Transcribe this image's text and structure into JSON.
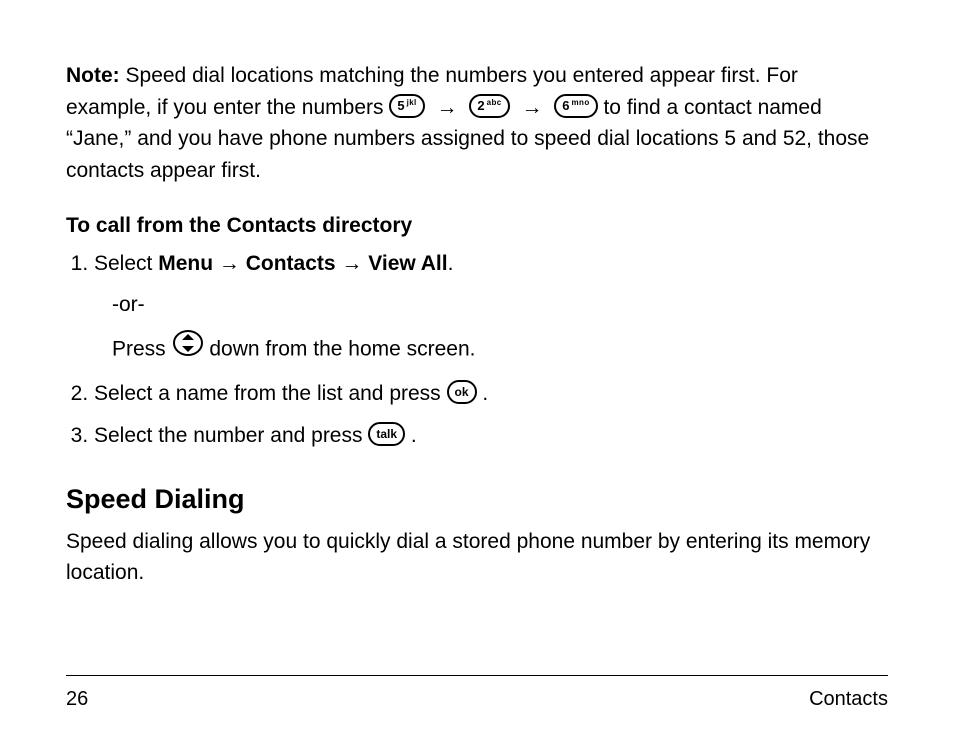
{
  "note": {
    "label": "Note:",
    "text_before_keys": " Speed dial locations matching the numbers you entered appear first. For example, if you enter the numbers ",
    "key1_num": "5",
    "key1_sup": "jkl",
    "arrow": "→",
    "key2_num": "2",
    "key2_sup": "abc",
    "key3_num": "6",
    "key3_sup": "mno",
    "text_after_keys": " to find a contact named “Jane,” and you have phone numbers assigned to speed dial locations 5 and 52, those contacts appear first."
  },
  "subheading": "To call from the Contacts directory",
  "step1": {
    "pre": "Select ",
    "menu": "Menu",
    "arrow": " → ",
    "contacts": "Contacts",
    "viewall": "View All",
    "period": ".",
    "or": "-or-",
    "press": "Press ",
    "after_icon": " down from the home screen."
  },
  "step2": {
    "pre": "Select a name from the list and press ",
    "ok_label": "ok",
    "post": " ."
  },
  "step3": {
    "pre": "Select the number and press ",
    "talk_label": "talk",
    "post": " ."
  },
  "section_heading": "Speed Dialing",
  "section_body": "Speed dialing allows you to quickly dial a stored phone number by entering its memory location.",
  "footer": {
    "page_number": "26",
    "section": "Contacts"
  }
}
